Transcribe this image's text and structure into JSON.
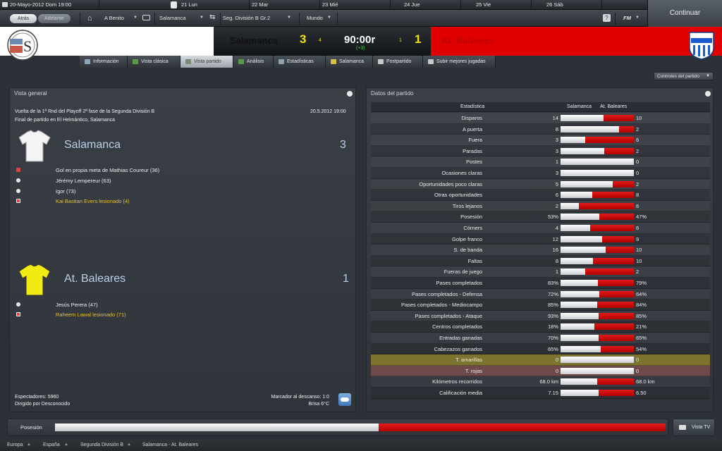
{
  "topbar": {
    "date": "20-Mayo-2012  Dom  19:00",
    "days": [
      "21 Lun",
      "22 Mar",
      "23 Mié",
      "24 Jue",
      "25 Vie",
      "26 Sáb"
    ]
  },
  "nav": {
    "back": "Atrás",
    "forward": "Adelante",
    "manager": "A Benito",
    "team": "Salamanca",
    "competition": "Seg. División B Gr.2",
    "world": "Mundo",
    "help": "?",
    "fm": "FM",
    "continue": "Continuar"
  },
  "score": {
    "home_team": "Salamanca",
    "home_goals": "3",
    "home_small": "4",
    "time": "90:00r",
    "added": "(+3)",
    "away_small": "1",
    "away_goals": "1",
    "away_team": "At. Baleares",
    "colors": {
      "home": "#ffffff",
      "away": "#e00000",
      "score": "#f4e20a"
    }
  },
  "tabs": [
    {
      "label": "Información",
      "icon": "info-icon"
    },
    {
      "label": "Vista clásica",
      "icon": "pitch-icon"
    },
    {
      "label": "Vista partido",
      "icon": "match-view-icon"
    },
    {
      "label": "Análisis",
      "icon": "analysis-icon"
    },
    {
      "label": "Estadísticas",
      "icon": "stats-icon"
    },
    {
      "label": "Salamanca",
      "icon": "tactics-icon"
    },
    {
      "label": "Postpartido",
      "icon": "whistle-icon"
    },
    {
      "label": "Subir mejores jugadas",
      "icon": "upload-icon"
    }
  ],
  "controls": "Controles del partido",
  "overview": {
    "title": "Vista general",
    "round": "Vuelta de la 1ª Rnd del Playoff 2ª fase de la Segunda División B",
    "datetime": "20.5.2012 19:00",
    "venue": "Final de partido en El Helmántico, Salamanca",
    "home": {
      "name": "Salamanca",
      "goals": "3",
      "events": [
        {
          "text": "Gol en propia meta de Mathias Coureur (36)",
          "type": "own-goal"
        },
        {
          "text": "Jérémy Lempereur (63)",
          "type": "goal"
        },
        {
          "text": "Igor (73)",
          "type": "goal"
        },
        {
          "text": "Kai Bastian Evers lesionado (4)",
          "type": "injury"
        }
      ]
    },
    "away": {
      "name": "At. Baleares",
      "goals": "1",
      "events": [
        {
          "text": "Jesús Perera (47)",
          "type": "goal"
        },
        {
          "text": "Raheem Lawal lesionado (71)",
          "type": "injury"
        }
      ]
    },
    "spectators": "Espectadores: 5960",
    "referee": "Dirigido por Desconocido",
    "halftime": "Marcador al descanso: 1:0",
    "weather": "Brisa 6°C"
  },
  "stats": {
    "title": "Datos del partido",
    "col_stat": "Estadística",
    "col_home": "Salamanca",
    "col_away": "At. Baleares",
    "rows": [
      {
        "label": "Disparos",
        "home": "14",
        "away": "10",
        "hs": 14,
        "as": 10
      },
      {
        "label": "A puerta",
        "home": "8",
        "away": "2",
        "hs": 8,
        "as": 2
      },
      {
        "label": "Fuera",
        "home": "3",
        "away": "6",
        "hs": 3,
        "as": 6
      },
      {
        "label": "Paradas",
        "home": "3",
        "away": "2",
        "hs": 3,
        "as": 2
      },
      {
        "label": "Postes",
        "home": "1",
        "away": "0",
        "hs": 1,
        "as": 0
      },
      {
        "label": "Ocasiones claras",
        "home": "3",
        "away": "0",
        "hs": 3,
        "as": 0
      },
      {
        "label": "Oportunidades poco claras",
        "home": "5",
        "away": "2",
        "hs": 5,
        "as": 2
      },
      {
        "label": "Otras oportunidades",
        "home": "6",
        "away": "8",
        "hs": 6,
        "as": 8
      },
      {
        "label": "Tiros lejanos",
        "home": "2",
        "away": "6",
        "hs": 2,
        "as": 6
      },
      {
        "label": "Posesión",
        "home": "53%",
        "away": "47%",
        "hs": 53,
        "as": 47
      },
      {
        "label": "Córners",
        "home": "4",
        "away": "6",
        "hs": 4,
        "as": 6
      },
      {
        "label": "Golpe franco",
        "home": "12",
        "away": "9",
        "hs": 12,
        "as": 9
      },
      {
        "label": "S. de banda",
        "home": "16",
        "away": "10",
        "hs": 16,
        "as": 10
      },
      {
        "label": "Faltas",
        "home": "8",
        "away": "10",
        "hs": 8,
        "as": 10
      },
      {
        "label": "Fueras de juego",
        "home": "1",
        "away": "2",
        "hs": 1,
        "as": 2
      },
      {
        "label": "Pases completados",
        "home": "83%",
        "away": "79%",
        "hs": 83,
        "as": 79
      },
      {
        "label": "Pases completados - Defensa",
        "home": "72%",
        "away": "64%",
        "hs": 72,
        "as": 64
      },
      {
        "label": "Pases completados - Mediocampo",
        "home": "85%",
        "away": "84%",
        "hs": 85,
        "as": 84
      },
      {
        "label": "Pases completados - Ataque",
        "home": "93%",
        "away": "85%",
        "hs": 93,
        "as": 85
      },
      {
        "label": "Centros completados",
        "home": "18%",
        "away": "21%",
        "hs": 18,
        "as": 21
      },
      {
        "label": "Entradas ganadas",
        "home": "70%",
        "away": "65%",
        "hs": 70,
        "as": 65
      },
      {
        "label": "Cabezazos ganados",
        "home": "65%",
        "away": "54%",
        "hs": 65,
        "as": 54
      },
      {
        "label": "T. amarillas",
        "home": "0",
        "away": "0",
        "hs": 0,
        "as": 0,
        "hl": "#7d7330"
      },
      {
        "label": "T. rojas",
        "home": "0",
        "away": "0",
        "hs": 0,
        "as": 0,
        "hl": "#6e4a4a"
      },
      {
        "label": "Kilómetros recorridos",
        "home": "68.0 km",
        "away": "68.0 km",
        "hs": 68,
        "as": 68
      },
      {
        "label": "Calificación media",
        "home": "7.15",
        "away": "6.50",
        "hs": 7.15,
        "as": 6.5
      }
    ]
  },
  "possession": {
    "label": "Posesión",
    "home": 53,
    "away": 47,
    "tv": "Vista TV"
  },
  "breadcrumb": [
    "Europa",
    "España",
    "Segunda División B",
    "Salamanca - At. Baleares"
  ]
}
